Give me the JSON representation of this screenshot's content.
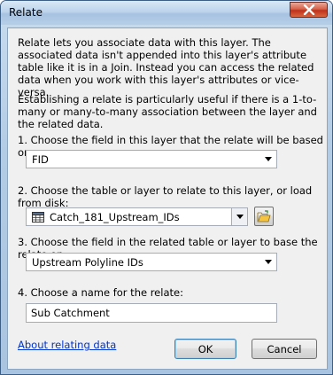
{
  "window": {
    "title": "Relate",
    "close_icon": "close-icon"
  },
  "description": [
    "Relate lets you associate data with this layer. The associated data isn't appended into this layer's attribute table like it is in a Join. Instead you can access the related data when you work with this layer's attributes or vice-versa.",
    "Establishing a relate is particularly useful if there is a 1-to-many or many-to-many association between the layer and the related data."
  ],
  "step1": {
    "label": "1. Choose the field in this layer that the relate will be based on:",
    "value": "FID"
  },
  "step2": {
    "label": "2. Choose the table or layer to relate to this layer, or load from disk:",
    "value": "Catch_181_Upstream_IDs",
    "icon": "table-icon",
    "browse_icon": "open-folder-icon"
  },
  "step3": {
    "label": "3. Choose the field in the related table or layer to base the relate on:",
    "value": "Upstream Polyline IDs"
  },
  "step4": {
    "label": "4. Choose a name for the relate:",
    "value": "Sub Catchment"
  },
  "footer": {
    "help_link": "About relating data",
    "ok_label": "OK",
    "cancel_label": "Cancel"
  }
}
